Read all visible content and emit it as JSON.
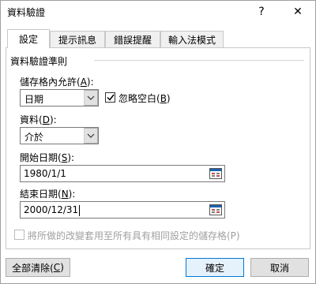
{
  "window": {
    "title": "資料驗證",
    "help_glyph": "?",
    "close_glyph": "✕"
  },
  "tabs": [
    {
      "label": "設定"
    },
    {
      "label": "提示訊息"
    },
    {
      "label": "錯誤提醒"
    },
    {
      "label": "輸入法模式"
    }
  ],
  "criteria": {
    "group_title": "資料驗證準則",
    "allow": {
      "label_prefix": "儲存格內允許(",
      "accel": "A",
      "label_suffix": "):",
      "value": "日期"
    },
    "ignore_blank": {
      "label_prefix": "忽略空白(",
      "accel": "B",
      "label_suffix": ")",
      "checked": true
    },
    "data": {
      "label_prefix": "資料(",
      "accel": "D",
      "label_suffix": "):",
      "value": "介於"
    },
    "start_date": {
      "label_prefix": "開始日期(",
      "accel": "S",
      "label_suffix": "):",
      "value": "1980/1/1"
    },
    "end_date": {
      "label_prefix": "結束日期(",
      "accel": "N",
      "label_suffix": "):",
      "value": "2000/12/31"
    },
    "apply_all": {
      "label": "將所做的改變套用至所有具有相同設定的儲存格(P)",
      "checked": false,
      "enabled": false
    }
  },
  "buttons": {
    "clear_prefix": "全部清除(",
    "clear_accel": "C",
    "clear_suffix": ")",
    "ok": "確定",
    "cancel": "取消"
  },
  "icons": {
    "collapse_ref_icon": "collapse-dialog",
    "dropdown_arrow": "chevron-down"
  }
}
